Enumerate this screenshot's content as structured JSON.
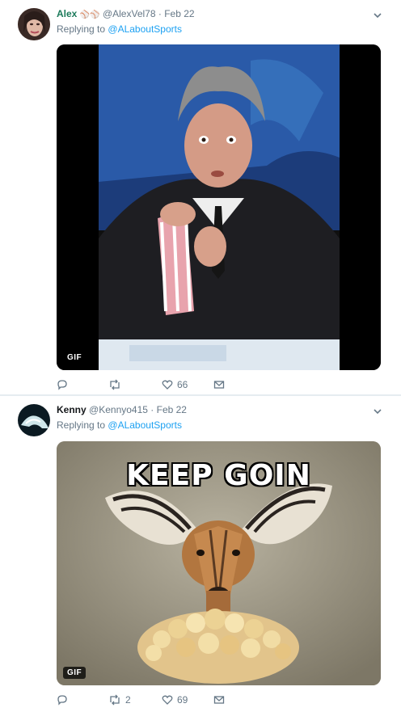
{
  "tweets": [
    {
      "name": "Alex",
      "name_emoji": "⚾⚾",
      "handle": "@AlexVel78",
      "separator": "·",
      "date": "Feb 22",
      "replying_prefix": "Replying to",
      "replying_to": "@ALaboutSports",
      "media_badge": "GIF",
      "actions": {
        "reply_count": "",
        "retweet_count": "",
        "like_count": "66"
      }
    },
    {
      "name": "Kenny",
      "handle": "@Kennyo415",
      "separator": "·",
      "date": "Feb 22",
      "replying_prefix": "Replying to",
      "replying_to": "@ALaboutSports",
      "media_caption": "KEEP GOIN",
      "media_badge": "GIF",
      "actions": {
        "reply_count": "",
        "retweet_count": "2",
        "like_count": "69"
      }
    }
  ],
  "icons": [
    "chevron-down-icon",
    "reply-icon",
    "retweet-icon",
    "heart-icon",
    "message-icon"
  ],
  "colors": {
    "accent": "#1da1f2",
    "muted": "#657786",
    "divider": "#e6ecf0"
  }
}
